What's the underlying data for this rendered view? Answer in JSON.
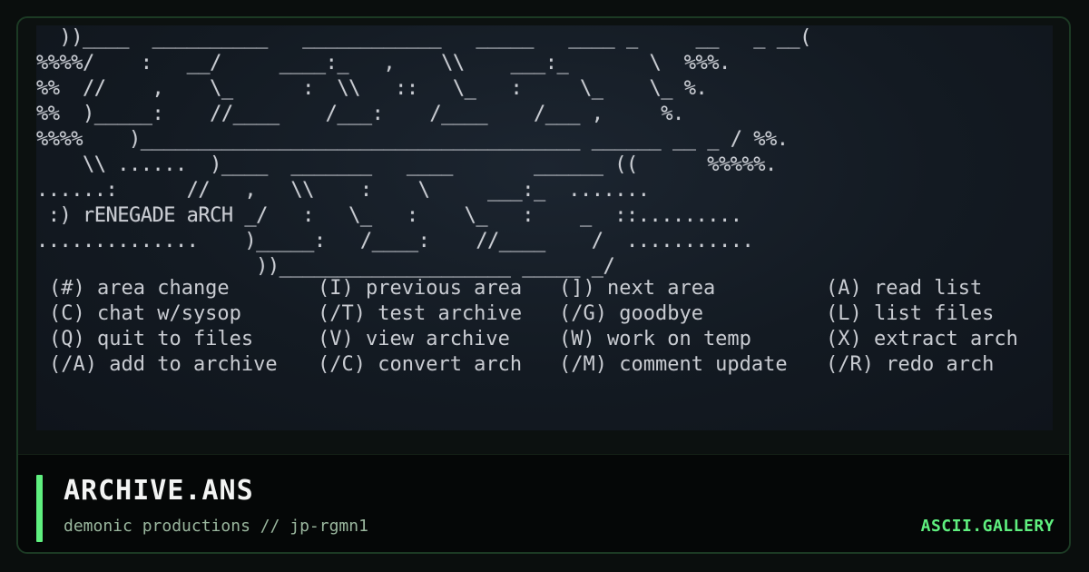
{
  "art": {
    "ansi_lines": [
      "  ))____  __________   ____________   _____   ____ _     __   _ __(",
      "%%%%/    :   __/     ____:_   ,    \\\\    ___:_       \\  %%%.",
      "%%  //    ,    \\_      :  \\\\   ::   \\_   :     \\_    \\_ %.",
      "%%  )_____:    //____    /___:    /____    /___ ,     %.",
      "%%%%    )______________________________________ ______ __ _ / %%.",
      "    \\\\ ......  )____  _______   ____       ______ ((      %%%%%.",
      "......:      //   ,   \\\\    :    \\     ___:_  .......",
      " :) rENEGADE aRCH _/   :   \\_   :    \\_   :    _  ::.........",
      "..............    )_____:   /____:    //____    /  ...........",
      "                   ))____________________ _____ _/"
    ],
    "title_text": "rENEGADE aRCH",
    "menu": [
      [
        "(#) area change",
        "(I) previous area",
        "(]) next area",
        "(A) read list"
      ],
      [
        "(C) chat w/sysop",
        "(/T) test archive",
        "(/G) goodbye",
        "(L) list files"
      ],
      [
        "(Q) quit to files",
        "(V) view archive",
        "(W) work on temp",
        "(X) extract arch"
      ],
      [
        "(/A) add to archive",
        "(/C) convert arch",
        "(/M) comment update",
        "(/R) redo arch"
      ]
    ]
  },
  "footer": {
    "title": "ARCHIVE.ANS",
    "subtitle": "demonic productions // jp-rgmn1",
    "brand": "ASCII.GALLERY"
  },
  "colors": {
    "accent": "#5ff07f",
    "art_text": "#c9ccd2",
    "art_violet": "#8c6bd3",
    "background": "#0a0e0d"
  }
}
